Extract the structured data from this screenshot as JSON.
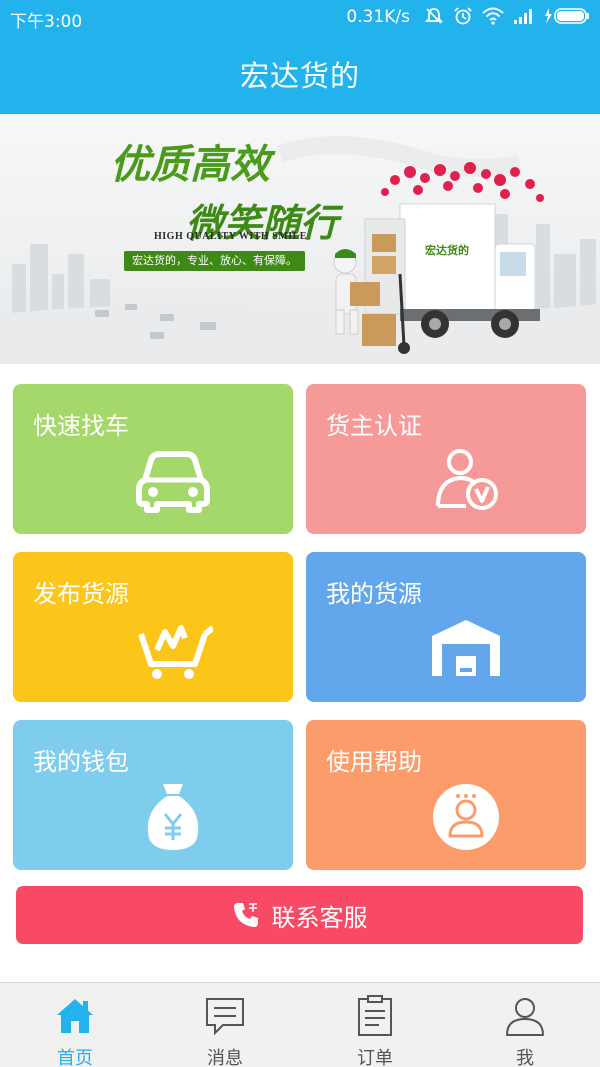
{
  "status_bar": {
    "time": "下午3:00",
    "network_speed": "0.31K/s",
    "icons": [
      "mute-icon",
      "alarm-icon",
      "wifi-icon",
      "signal-icon",
      "battery-icon"
    ]
  },
  "header": {
    "title": "宏达货的"
  },
  "banner": {
    "headline_1": "优质高效",
    "headline_2": "微笑随行",
    "english": "HIGH QUALITY WITH SMILE",
    "tagline": "宏达货的，专业、放心、有保障。",
    "truck_label": "宏达货的"
  },
  "tiles": [
    {
      "label": "快速找车",
      "icon": "car-icon",
      "color": "#a5d86a"
    },
    {
      "label": "货主认证",
      "icon": "user-verified-icon",
      "color": "#f59a99"
    },
    {
      "label": "发布货源",
      "icon": "cart-icon",
      "color": "#fcc51a"
    },
    {
      "label": "我的货源",
      "icon": "warehouse-icon",
      "color": "#62a6ec"
    },
    {
      "label": "我的钱包",
      "icon": "money-bag-icon",
      "color": "#7fcdec"
    },
    {
      "label": "使用帮助",
      "icon": "help-person-icon",
      "color": "#fd9c6b"
    }
  ],
  "contact_button": {
    "label": "联系客服",
    "color": "#f84a65"
  },
  "tabs": [
    {
      "label": "首页",
      "icon": "home-icon",
      "active": true
    },
    {
      "label": "消息",
      "icon": "message-icon",
      "active": false
    },
    {
      "label": "订单",
      "icon": "order-icon",
      "active": false
    },
    {
      "label": "我",
      "icon": "profile-icon",
      "active": false
    }
  ],
  "colors": {
    "primary": "#23b3ec"
  }
}
